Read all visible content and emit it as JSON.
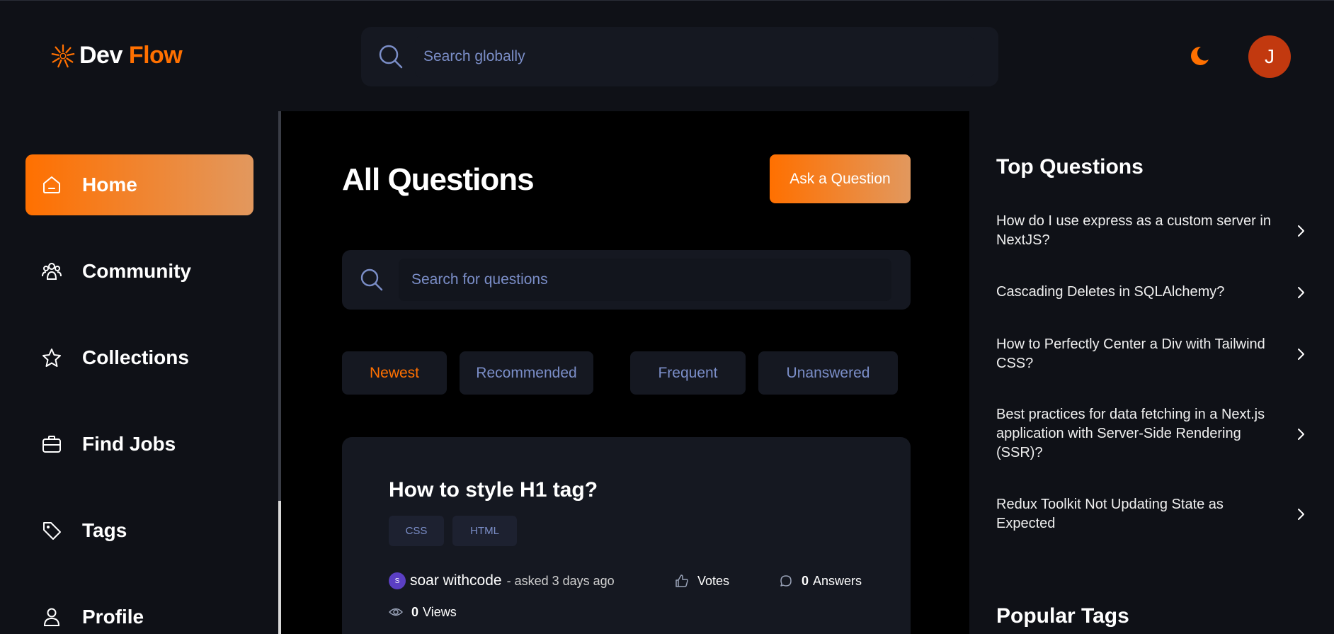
{
  "brand": {
    "name_part1": "Dev",
    "name_part2": "Flow",
    "accent": "#ff7000"
  },
  "header": {
    "search_placeholder": "Search globally",
    "theme_icon": "moon-icon",
    "avatar_initial": "J"
  },
  "sidebar": {
    "items": [
      {
        "label": "Home",
        "icon": "home-icon",
        "active": true
      },
      {
        "label": "Community",
        "icon": "users-icon",
        "active": false
      },
      {
        "label": "Collections",
        "icon": "star-icon",
        "active": false
      },
      {
        "label": "Find Jobs",
        "icon": "briefcase-icon",
        "active": false
      },
      {
        "label": "Tags",
        "icon": "tag-icon",
        "active": false
      },
      {
        "label": "Profile",
        "icon": "user-icon",
        "active": false
      }
    ]
  },
  "main": {
    "title": "All Questions",
    "ask_button": "Ask a Question",
    "search_placeholder": "Search for questions",
    "filters": [
      {
        "label": "Newest",
        "active": true
      },
      {
        "label": "Recommended",
        "active": false
      },
      {
        "label": "Frequent",
        "active": false
      },
      {
        "label": "Unanswered",
        "active": false
      }
    ],
    "questions": [
      {
        "title": "How to style H1 tag?",
        "tags": [
          "CSS",
          "HTML"
        ],
        "author_initial": "S",
        "author": "soar withcode",
        "asked": "- asked 3 days ago",
        "votes_label": "Votes",
        "answers_count": "0",
        "answers_label": "Answers",
        "views_count": "0",
        "views_label": "Views"
      }
    ]
  },
  "right_sidebar": {
    "top_questions_title": "Top Questions",
    "top_questions": [
      "How do I use express as a custom server in NextJS?",
      "Cascading Deletes in SQLAlchemy?",
      "How to Perfectly Center a Div with Tailwind CSS?",
      "Best practices for data fetching in a Next.js application with Server-Side Rendering (SSR)?",
      "Redux Toolkit Not Updating State as Expected"
    ],
    "popular_tags_title": "Popular Tags"
  }
}
